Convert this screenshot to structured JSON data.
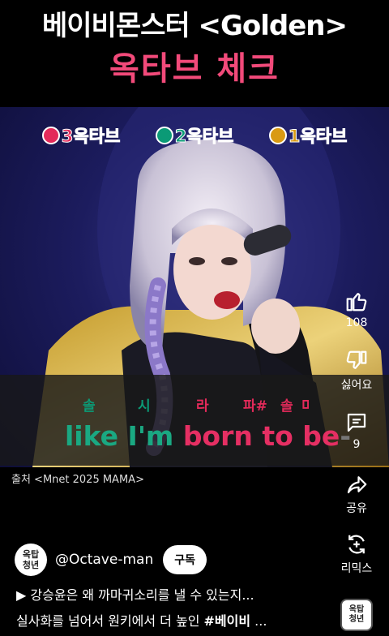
{
  "header": {
    "title_line1": "베이비몬스터 <Golden>",
    "title_line2": "옥타브 체크"
  },
  "legend": [
    {
      "label": "3옥타브",
      "color": "#e32a5a"
    },
    {
      "label": "2옥타브",
      "color": "#0b9a76"
    },
    {
      "label": "1옥타브",
      "color": "#d99a12"
    }
  ],
  "notes": [
    "솔",
    "시",
    "라",
    "파#",
    "솔",
    "미"
  ],
  "lyric": {
    "part1": "like I'm ",
    "part2": "born to be",
    "part3": "-"
  },
  "source": "출처 <Mnet 2025 MAMA>",
  "actions": {
    "like_count": "108",
    "dislike_label": "싫어요",
    "comment_count": "9",
    "share_label": "공유",
    "remix_label": "리믹스"
  },
  "channel": {
    "avatar_top": "옥탑",
    "avatar_bottom": "청년",
    "handle": "@Octave-man",
    "subscribe_label": "구독"
  },
  "playlist_text": "▶  강승윤은 왜 까마귀소리를 낼 수 있는지...",
  "description": {
    "prefix": "실사화를 넘어서 원키에서 더 높인 ",
    "hashtag": "#베이비",
    "suffix": " ..."
  },
  "sound_thumb": {
    "top": "옥탑",
    "bottom": "청년"
  },
  "colors": {
    "accent": "#f24a7a",
    "octave3": "#e32a5a",
    "octave2": "#0b9a76",
    "octave1": "#d99a12"
  },
  "icons": [
    "thumbs-up-icon",
    "thumbs-down-icon",
    "comment-icon",
    "share-icon",
    "remix-icon"
  ]
}
